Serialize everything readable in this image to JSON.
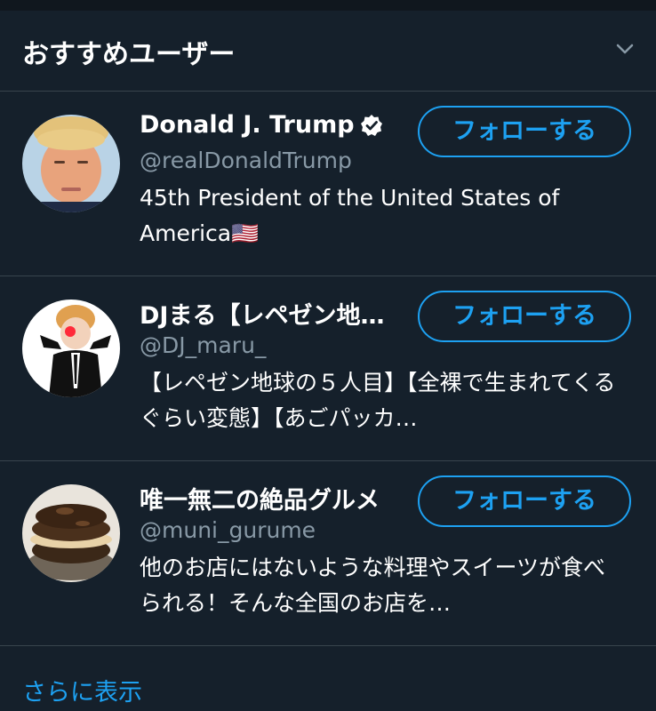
{
  "header": {
    "title": "おすすめユーザー",
    "collapse_icon": "chevron-down-icon"
  },
  "users": [
    {
      "name": "Donald J. Trump",
      "verified": true,
      "handle": "@realDonaldTrump",
      "bio": "45th President of the United States of America🇺🇸",
      "follow_label": "フォローする"
    },
    {
      "name": "DJまる【レペゼン地…",
      "verified": false,
      "handle": "@DJ_maru_",
      "bio": "【レペゼン地球の５人目】【全裸で生まれてくるぐらい変態】【あごパッカ…",
      "follow_label": "フォローする"
    },
    {
      "name": "唯一無二の絶品グルメ",
      "verified": false,
      "handle": "@muni_gurume",
      "bio": "他のお店にはないような料理やスイーツが食べられる！そんな全国のお店を…",
      "follow_label": "フォローする"
    }
  ],
  "footer": {
    "show_more_label": "さらに表示"
  },
  "colors": {
    "background": "#15202b",
    "accent": "#1da1f2",
    "secondary_text": "#8899a6",
    "divider": "#38444d"
  }
}
